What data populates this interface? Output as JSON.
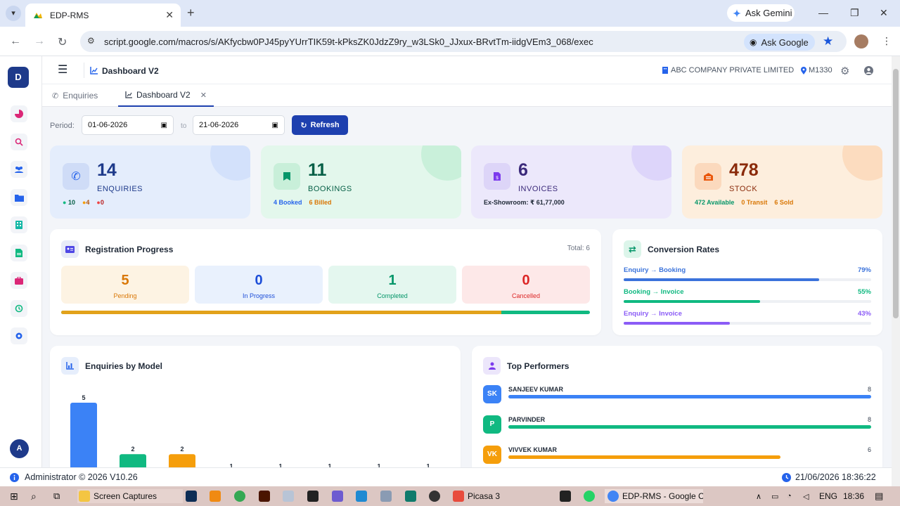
{
  "browser": {
    "tab_title": "EDP-RMS",
    "ask_gemini": "Ask Gemini",
    "url": "script.google.com/macros/s/AKfycbw0PJ45pyYUrrTIK59t-kPksZK0JdzZ9ry_w3LSk0_JJxux-BRvtTm-iidgVEm3_068/exec",
    "ask_google": "Ask Google"
  },
  "app": {
    "logo_letter": "D",
    "page_title": "Dashboard V2",
    "company": "ABC COMPANY PRIVATE LIMITED",
    "location": "M1330",
    "user_initial": "A",
    "tabs": [
      {
        "label": "Enquiries"
      },
      {
        "label": "Dashboard V2"
      }
    ]
  },
  "filters": {
    "period_label": "Period:",
    "from_date": "01-06-2026",
    "to_label": "to",
    "to_date": "21-06-2026",
    "refresh_label": "Refresh"
  },
  "kpis": [
    {
      "value": "14",
      "label": "ENQUIRIES",
      "subs": [
        "10",
        "4",
        "0"
      ],
      "color": "#1e3a8a",
      "bg": "#e4edfc"
    },
    {
      "value": "11",
      "label": "BOOKINGS",
      "subs": [
        "4 Booked",
        "6 Billed"
      ],
      "color": "#065f46",
      "bg": "#e3f7ec"
    },
    {
      "value": "6",
      "label": "INVOICES",
      "subs": [
        "Ex-Showroom: ₹ 61,77,000"
      ],
      "color": "#3b2a7a",
      "bg": "#ece8fb"
    },
    {
      "value": "478",
      "label": "STOCK",
      "subs": [
        "472 Available",
        "0 Transit",
        "6 Sold"
      ],
      "color": "#8a2a0a",
      "bg": "#fdeedd"
    }
  ],
  "registration": {
    "title": "Registration Progress",
    "total": "Total: 6",
    "stats": [
      {
        "value": "5",
        "label": "Pending",
        "color": "#d97706",
        "bg": "#fdf3e3"
      },
      {
        "value": "0",
        "label": "In Progress",
        "color": "#1d4ed8",
        "bg": "#e9f1fd"
      },
      {
        "value": "1",
        "label": "Completed",
        "color": "#059669",
        "bg": "#e4f7ef"
      },
      {
        "value": "0",
        "label": "Cancelled",
        "color": "#dc2626",
        "bg": "#fde8e8"
      }
    ],
    "progress_fraction": 0.833
  },
  "conversion": {
    "title": "Conversion Rates",
    "rows": [
      {
        "label": "Enquiry → Booking",
        "value": "79%",
        "fraction": 0.79,
        "color": "#3b73db"
      },
      {
        "label": "Booking → Invoice",
        "value": "55%",
        "fraction": 0.55,
        "color": "#10b981"
      },
      {
        "label": "Enquiry → Invoice",
        "value": "43%",
        "fraction": 0.43,
        "color": "#8b5cf6"
      }
    ]
  },
  "model_chart": {
    "title": "Enquiries by Model",
    "chart_data": {
      "type": "bar",
      "values": [
        5,
        2,
        2,
        1,
        1,
        1,
        1,
        1
      ],
      "colors": [
        "#3b82f6",
        "#10b981",
        "#f59e0b",
        "#ef4444",
        "#8b5cf6",
        "#06b6d4",
        "#f97316",
        "#ec4899"
      ]
    }
  },
  "performers": {
    "title": "Top Performers",
    "rows": [
      {
        "initials": "SK",
        "name": "SANJEEV KUMAR",
        "count": "8",
        "fraction": 1.0,
        "color": "#3b82f6"
      },
      {
        "initials": "P",
        "name": "PARVINDER",
        "count": "8",
        "fraction": 1.0,
        "color": "#10b981"
      },
      {
        "initials": "VK",
        "name": "VIVVEK KUMAR",
        "count": "6",
        "fraction": 0.75,
        "color": "#f59e0b"
      }
    ]
  },
  "footer": {
    "left": "Administrator © 2026 V10.26",
    "right": "21/06/2026 18:36:22"
  },
  "taskbar": {
    "folder": "Screen Captures",
    "picasa": "Picasa 3",
    "chrome": "EDP-RMS - Google C...",
    "lang": "ENG",
    "time": "18:36"
  }
}
